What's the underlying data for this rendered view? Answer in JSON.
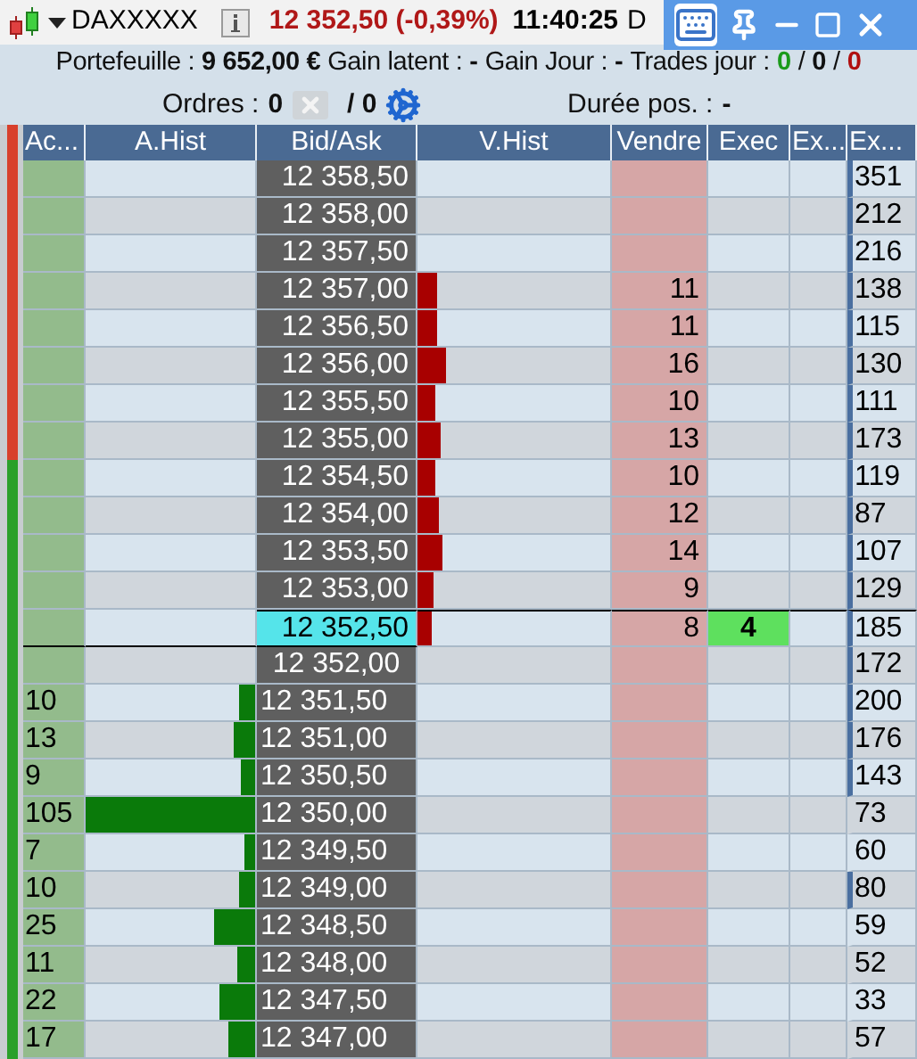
{
  "title_bar": {
    "instrument": "DAXXXXX",
    "price_change": "12 352,50 (-0,39%)",
    "time": "11:40:25",
    "cut_text": "D"
  },
  "summary": [
    {
      "text": "Portefeuille :",
      "bold": false,
      "color": "#111111"
    },
    {
      "text": "9 652,00 €",
      "bold": true,
      "color": "#111111"
    },
    {
      "text": "Gain latent :",
      "bold": false,
      "color": "#111111"
    },
    {
      "text": "-",
      "bold": true,
      "color": "#111111"
    },
    {
      "text": "Gain Jour :",
      "bold": false,
      "color": "#111111"
    },
    {
      "text": "-",
      "bold": true,
      "color": "#111111"
    },
    {
      "text": "Trades jour :",
      "bold": false,
      "color": "#111111"
    },
    {
      "text": "0",
      "bold": true,
      "color": "#1a9a1a"
    },
    {
      "text": "/",
      "bold": false,
      "color": "#111111"
    },
    {
      "text": "0",
      "bold": true,
      "color": "#111111"
    },
    {
      "text": "/",
      "bold": false,
      "color": "#111111"
    },
    {
      "text": "0",
      "bold": true,
      "color": "#b01010"
    }
  ],
  "orders": {
    "label": "Ordres :",
    "count": "0",
    "separator": "/ 0",
    "cancel_disabled": true,
    "duration_label": "Durée pos. :",
    "duration": "-"
  },
  "table": {
    "header_strip": {
      "color": "#d8402c"
    },
    "columns": [
      "Ac...",
      "A.Hist",
      "Bid/Ask",
      "V.Hist",
      "Vendre",
      "Exec",
      "Ex...",
      "Ex..."
    ],
    "rows": [
      {
        "kind": "ask",
        "color": "#d8402c",
        "price": "12 358,50",
        "ex": "351",
        "marker": true
      },
      {
        "kind": "ask",
        "color": "#d8402c",
        "price": "12 358,00",
        "ex": "212",
        "marker": true
      },
      {
        "kind": "ask",
        "color": "#d8402c",
        "price": "12 357,50",
        "ex": "216",
        "marker": true
      },
      {
        "kind": "ask",
        "color": "#d8402c",
        "price": "12 357,00",
        "vendre": "11",
        "bar": {
          "level": 0.1
        },
        "ex": "138",
        "marker": true
      },
      {
        "kind": "ask",
        "color": "#d8402c",
        "price": "12 356,50",
        "vendre": "11",
        "bar": {
          "level": 0.1
        },
        "ex": "115",
        "marker": true
      },
      {
        "kind": "ask",
        "color": "#d8402c",
        "price": "12 356,00",
        "vendre": "16",
        "bar": {
          "level": 0.147
        },
        "ex": "130",
        "marker": true
      },
      {
        "kind": "ask",
        "color": "#d8402c",
        "price": "12 355,50",
        "vendre": "10",
        "bar": {
          "level": 0.092
        },
        "ex": "111",
        "marker": true
      },
      {
        "kind": "ask",
        "color": "#d8402c",
        "price": "12 355,00",
        "vendre": "13",
        "bar": {
          "level": 0.119
        },
        "ex": "173",
        "marker": true
      },
      {
        "kind": "ask",
        "color": "#2aa02a",
        "price": "12 354,50",
        "vendre": "10",
        "bar": {
          "level": 0.092
        },
        "ex": "119",
        "marker": true
      },
      {
        "kind": "ask",
        "color": "#2aa02a",
        "price": "12 354,00",
        "vendre": "12",
        "bar": {
          "level": 0.11
        },
        "ex": "87",
        "marker": true
      },
      {
        "kind": "ask",
        "color": "#2aa02a",
        "price": "12 353,50",
        "vendre": "14",
        "bar": {
          "level": 0.128
        },
        "ex": "107",
        "marker": true
      },
      {
        "kind": "ask",
        "color": "#2aa02a",
        "price": "12 353,00",
        "vendre": "9",
        "bar": {
          "level": 0.083
        },
        "ex": "129",
        "marker": true
      },
      {
        "kind": "last",
        "color": "#2aa02a",
        "price": "12 352,50",
        "vendre": "8",
        "bar": {
          "level": 0.073
        },
        "exec": "4",
        "ex": "185",
        "marker": true
      },
      {
        "kind": "mid",
        "color": "#2aa02a",
        "price": "12 352,00",
        "ex": "172",
        "marker": true
      },
      {
        "kind": "bid",
        "color": "#2aa02a",
        "ac": "10",
        "bar": {
          "level": 0.095
        },
        "price": "12 351,50",
        "ex": "200",
        "marker": true
      },
      {
        "kind": "bid",
        "color": "#2aa02a",
        "ac": "13",
        "bar": {
          "level": 0.124
        },
        "price": "12 351,00",
        "ex": "176",
        "marker": true
      },
      {
        "kind": "bid",
        "color": "#2aa02a",
        "ac": "9",
        "bar": {
          "level": 0.086
        },
        "price": "12 350,50",
        "ex": "143",
        "marker": true
      },
      {
        "kind": "bid",
        "color": "#2aa02a",
        "ac": "105",
        "bar": {
          "level": 1
        },
        "price": "12 350,00",
        "ex": "73",
        "marker": false
      },
      {
        "kind": "bid",
        "color": "#2aa02a",
        "ac": "7",
        "bar": {
          "level": 0.067
        },
        "price": "12 349,50",
        "ex": "60",
        "marker": false
      },
      {
        "kind": "bid",
        "color": "#2aa02a",
        "ac": "10",
        "bar": {
          "level": 0.095
        },
        "price": "12 349,00",
        "ex": "80",
        "marker": true
      },
      {
        "kind": "bid",
        "color": "#2aa02a",
        "ac": "25",
        "bar": {
          "level": 0.238
        },
        "price": "12 348,50",
        "ex": "59",
        "marker": false
      },
      {
        "kind": "bid",
        "color": "#2aa02a",
        "ac": "11",
        "bar": {
          "level": 0.105
        },
        "price": "12 348,00",
        "ex": "52",
        "marker": false
      },
      {
        "kind": "bid",
        "color": "#2aa02a",
        "ac": "22",
        "bar": {
          "level": 0.21
        },
        "price": "12 347,50",
        "ex": "33",
        "marker": false
      },
      {
        "kind": "bid",
        "color": "#2aa02a",
        "ac": "17",
        "bar": {
          "level": 0.162
        },
        "price": "12 347,00",
        "ex": "57",
        "marker": false
      }
    ]
  }
}
